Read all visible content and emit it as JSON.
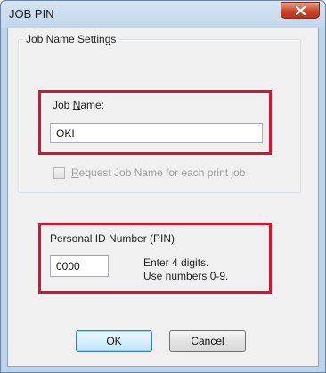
{
  "window": {
    "title": "JOB PIN"
  },
  "job_name_group": {
    "legend": "Job Name Settings",
    "label_prefix": "Job ",
    "label_mnemonic": "N",
    "label_suffix": "ame:",
    "value": "OKI",
    "request_checkbox": {
      "checked": false,
      "enabled": false,
      "label_mnemonic": "R",
      "label_rest": "equest Job Name for each print job"
    }
  },
  "pin_group": {
    "title": "Personal ID Number (PIN)",
    "value": "0000",
    "hint_line1": "Enter 4 digits.",
    "hint_line2": "Use numbers 0-9."
  },
  "buttons": {
    "ok": "OK",
    "cancel": "Cancel"
  },
  "colors": {
    "highlight_frame": "#d5142f",
    "titlebar": "#c2d6ec",
    "close_button": "#c9452a"
  }
}
